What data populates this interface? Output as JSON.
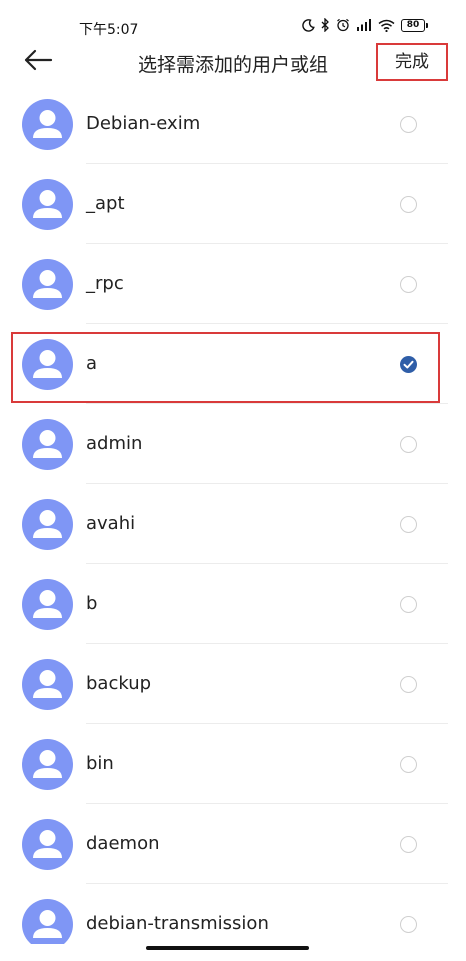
{
  "status_bar": {
    "time": "下午5:07",
    "battery": "80"
  },
  "header": {
    "title": "选择需添加的用户或组",
    "done_label": "完成"
  },
  "list": {
    "items": [
      {
        "label": "Debian-exim",
        "checked": false
      },
      {
        "label": "_apt",
        "checked": false
      },
      {
        "label": "_rpc",
        "checked": false
      },
      {
        "label": "a",
        "checked": true
      },
      {
        "label": "admin",
        "checked": false
      },
      {
        "label": "avahi",
        "checked": false
      },
      {
        "label": "b",
        "checked": false
      },
      {
        "label": "backup",
        "checked": false
      },
      {
        "label": "bin",
        "checked": false
      },
      {
        "label": "daemon",
        "checked": false
      },
      {
        "label": "debian-transmission",
        "checked": false
      }
    ]
  },
  "colors": {
    "avatar": "#7f96f5",
    "check": "#2f5ea8",
    "highlight": "#d93a3a"
  }
}
